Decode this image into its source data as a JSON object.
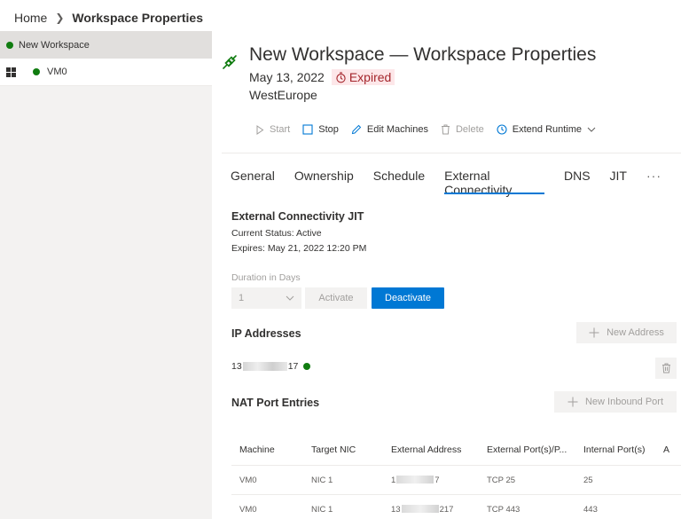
{
  "breadcrumb": {
    "home": "Home",
    "current": "Workspace Properties"
  },
  "sidebar": {
    "items": [
      {
        "label": "New Workspace",
        "status_color": "#107c10"
      },
      {
        "label": "VM0",
        "status_color": "#107c10",
        "icon": "windows-icon"
      }
    ]
  },
  "header": {
    "title": "New Workspace — Workspace Properties",
    "date": "May 13, 2022",
    "status_badge": "Expired",
    "region": "WestEurope",
    "icon": "connectivity-plug-icon"
  },
  "toolbar": {
    "start": "Start",
    "stop": "Stop",
    "edit_machines": "Edit Machines",
    "delete": "Delete",
    "extend_runtime": "Extend Runtime"
  },
  "tabs": [
    {
      "label": "General"
    },
    {
      "label": "Ownership"
    },
    {
      "label": "Schedule"
    },
    {
      "label": "External Connectivity",
      "active": true
    },
    {
      "label": "DNS"
    },
    {
      "label": "JIT"
    },
    {
      "label": "···"
    }
  ],
  "jit": {
    "title": "External Connectivity JIT",
    "status": "Current Status: Active",
    "expires": "Expires: May 21, 2022 12:20 PM",
    "duration_label": "Duration in Days",
    "duration_value": "1",
    "activate": "Activate",
    "deactivate": "Deactivate"
  },
  "ip": {
    "title": "IP Addresses",
    "new_button": "New Address",
    "address_start": "13",
    "address_end": "17",
    "status_color": "#107c10"
  },
  "nat": {
    "title": "NAT Port Entries",
    "new_button": "New Inbound Port",
    "columns": [
      "Machine",
      "Target NIC",
      "External Address",
      "External Port(s)/P...",
      "Internal Port(s)",
      "A"
    ],
    "rows": [
      {
        "machine": "VM0",
        "nic": "NIC 1",
        "addr_start": "1",
        "addr_end": "7",
        "ext_port": "TCP 25",
        "int_port": "25"
      },
      {
        "machine": "VM0",
        "nic": "NIC 1",
        "addr_start": "13",
        "addr_end": "217",
        "ext_port": "TCP 443",
        "int_port": "443"
      }
    ]
  },
  "colors": {
    "accent": "#0078d4",
    "success": "#107c10",
    "error_bg": "#fde7e9",
    "error_text": "#a4262c"
  }
}
